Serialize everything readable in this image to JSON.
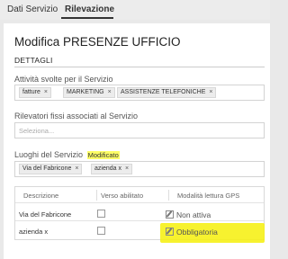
{
  "tabs": [
    {
      "label": "Dati Servizio",
      "active": false
    },
    {
      "label": "Rilevazione",
      "active": true
    }
  ],
  "page_title": "Modifica PRESENZE UFFICIO",
  "section_title": "DETTAGLI",
  "attivita": {
    "label": "Attività svolte per il Servizio",
    "chips": [
      "fatture",
      "MARKETING",
      "ASSISTENZE TELEFONICHE"
    ]
  },
  "rilevatori": {
    "label": "Rilevatori fissi associati al Servizio",
    "placeholder": "Seleziona..."
  },
  "luoghi": {
    "label": "Luoghi del Servizio",
    "badge": "Modificato",
    "chips": [
      "Via del Fabricone",
      "azienda x"
    ]
  },
  "table": {
    "headers": [
      "Descrizione",
      "Verso abilitato",
      "Modalità lettura GPS"
    ],
    "rows": [
      {
        "descrizione": "Via del Fabricone",
        "verso_abilitato": false,
        "gps": "Non attiva"
      },
      {
        "descrizione": "azienda x",
        "verso_abilitato": false,
        "gps": "Obbligatoria"
      }
    ]
  },
  "chip_remove_glyph": "×",
  "colors": {
    "highlight": "#f6f00a",
    "modified_badge": "#ffff66"
  }
}
